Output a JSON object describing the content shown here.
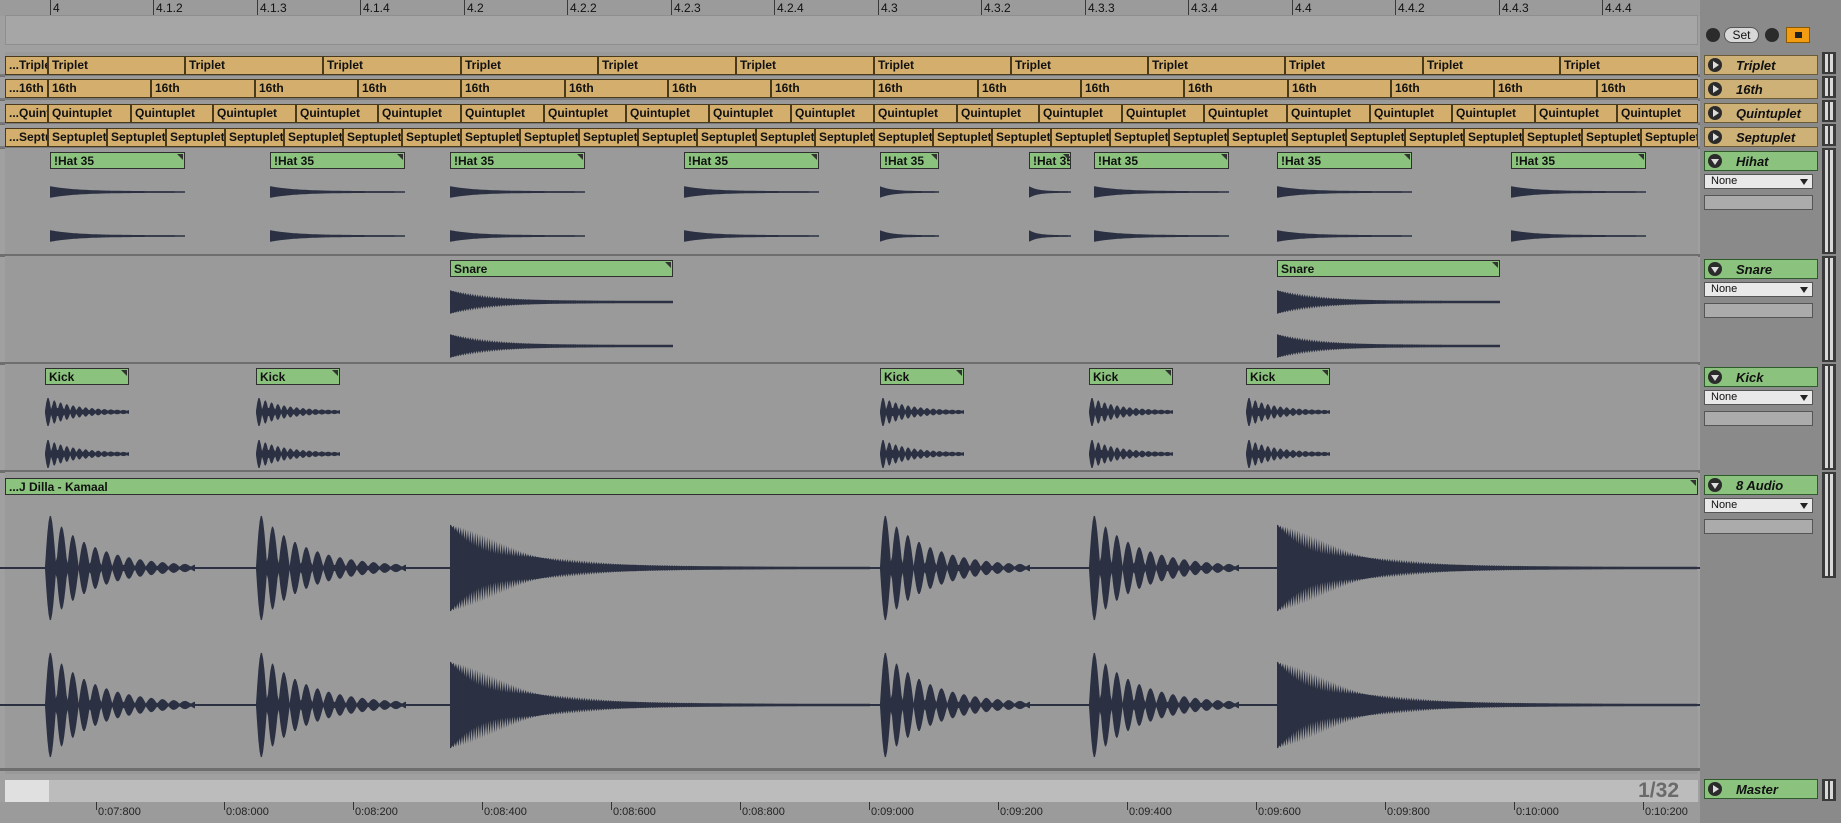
{
  "ruler": {
    "bars": [
      "4",
      "4.1.2",
      "4.1.3",
      "4.1.4",
      "4.2",
      "4.2.2",
      "4.2.3",
      "4.2.4",
      "4.3",
      "4.3.2",
      "4.3.3",
      "4.3.4",
      "4.4",
      "4.4.2",
      "4.4.3",
      "4.4.4"
    ]
  },
  "locator": {
    "set_label": "Set"
  },
  "tracks": [
    {
      "name": "Triplet",
      "type": "midi",
      "input": ""
    },
    {
      "name": "16th",
      "type": "midi",
      "input": ""
    },
    {
      "name": "Quintuplet",
      "type": "midi",
      "input": ""
    },
    {
      "name": "Septuplet",
      "type": "midi",
      "input": ""
    },
    {
      "name": "Hihat",
      "type": "audio",
      "input": "None"
    },
    {
      "name": "Snare",
      "type": "audio",
      "input": "None"
    },
    {
      "name": "Kick",
      "type": "audio",
      "input": "None"
    },
    {
      "name": "8 Audio",
      "type": "audio",
      "input": "None"
    }
  ],
  "clip_labels": {
    "triplet": "Triplet",
    "triplet_trunc": "...Triplet",
    "sixteenth": "16th",
    "sixteenth_trunc": "...16th",
    "quintuplet": "Quintuplet",
    "quintuplet_trunc": "...Quintuplet",
    "septuplet": "Septuplet",
    "septuplet_trunc": "...Septuplet",
    "hihat": "!Hat 35",
    "snare": "Snare",
    "kick": "Kick",
    "audio": "...J Dilla - Kamaal"
  },
  "master": {
    "name": "Master"
  },
  "zoom": {
    "label": "1/32"
  },
  "time_ruler": {
    "labels": [
      "0:07:800",
      "0:08:000",
      "0:08:200",
      "0:08:400",
      "0:08:600",
      "0:08:800",
      "0:09:000",
      "0:09:200",
      "0:09:400",
      "0:09:600",
      "0:09:800",
      "0:10:000",
      "0:10:200"
    ]
  },
  "colors": {
    "midi_clip": "#d3ae6c",
    "audio_clip": "#8bc27e",
    "waveform": "#2b3142",
    "background": "#999999"
  }
}
